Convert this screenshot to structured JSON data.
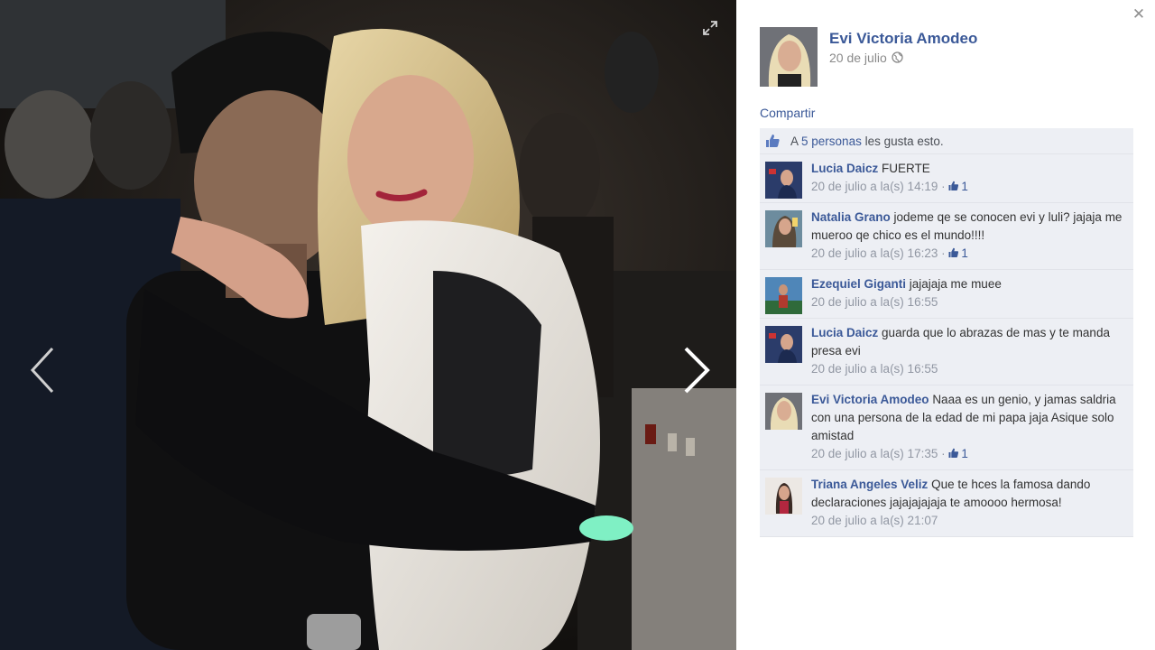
{
  "viewer": {
    "expand_icon": "expand-icon",
    "prev_icon": "chevron-left-icon",
    "next_icon": "chevron-right-icon",
    "close_glyph": "✕"
  },
  "post": {
    "owner_name": "Evi Victoria Amodeo",
    "date": "20 de julio",
    "privacy_icon": "globe-icon",
    "share_label": "Compartir",
    "likes_prefix": "A",
    "likes_link": "5 personas",
    "likes_suffix": "les gusta esto."
  },
  "comments": [
    {
      "author": "Lucia Daicz",
      "text": "FUERTE",
      "time": "20 de julio a la(s) 14:19",
      "likes": "1"
    },
    {
      "author": "Natalia Grano",
      "text": "jodeme qe se conocen evi y luli? jajaja me mueroo qe chico es el mundo!!!!",
      "time": "20 de julio a la(s) 16:23",
      "likes": "1"
    },
    {
      "author": "Ezequiel Giganti",
      "text": "jajajaja me muee",
      "time": "20 de julio a la(s) 16:55",
      "likes": ""
    },
    {
      "author": "Lucia Daicz",
      "text": "guarda que lo abrazas de mas y te manda presa evi",
      "time": "20 de julio a la(s) 16:55",
      "likes": ""
    },
    {
      "author": "Evi Victoria Amodeo",
      "text": "Naaa es un genio, y jamas saldria con una persona de la edad de mi papa jaja Asique solo amistad",
      "time": "20 de julio a la(s) 17:35",
      "likes": "1"
    },
    {
      "author": "Triana Angeles Veliz",
      "text": "Que te hces la famosa dando declaraciones jajajajajaja te amoooo hermosa!",
      "time": "20 de julio a la(s) 21:07",
      "likes": ""
    }
  ],
  "colors": {
    "link": "#3b5998",
    "comment_bg": "#edeff4",
    "meta": "#9197a3"
  }
}
